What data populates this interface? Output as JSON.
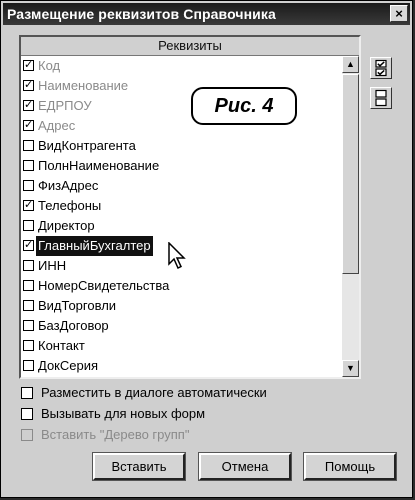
{
  "window": {
    "title": "Размещение реквизитов Справочника",
    "close_glyph": "×"
  },
  "list": {
    "header": "Реквизиты",
    "check_glyph": "✓",
    "items": [
      {
        "label": "Код",
        "checked": true,
        "disabled": true
      },
      {
        "label": "Наименование",
        "checked": true,
        "disabled": true
      },
      {
        "label": "ЕДРПОУ",
        "checked": true,
        "disabled": true
      },
      {
        "label": "Адрес",
        "checked": true,
        "disabled": true
      },
      {
        "label": "ВидКонтрагента",
        "checked": false,
        "disabled": false
      },
      {
        "label": "ПолнНаименование",
        "checked": false,
        "disabled": false
      },
      {
        "label": "ФизАдрес",
        "checked": false,
        "disabled": false
      },
      {
        "label": "Телефоны",
        "checked": true,
        "disabled": false
      },
      {
        "label": "Директор",
        "checked": false,
        "disabled": false
      },
      {
        "label": "ГлавныйБухгалтер",
        "checked": true,
        "disabled": false,
        "selected": true
      },
      {
        "label": "ИНН",
        "checked": false,
        "disabled": false
      },
      {
        "label": "НомерСвидетельства",
        "checked": false,
        "disabled": false
      },
      {
        "label": "ВидТорговли",
        "checked": false,
        "disabled": false
      },
      {
        "label": "БазДоговор",
        "checked": false,
        "disabled": false
      },
      {
        "label": "Контакт",
        "checked": false,
        "disabled": false
      },
      {
        "label": "ДокСерия",
        "checked": false,
        "disabled": false
      }
    ]
  },
  "scrollbar": {
    "up_glyph": "▲",
    "down_glyph": "▼"
  },
  "side_buttons": [
    {
      "icon": "check-all-icon"
    },
    {
      "icon": "uncheck-all-icon"
    }
  ],
  "figure_label": "Рис. 4",
  "options": [
    {
      "label": "Разместить в диалоге автоматически",
      "checked": false,
      "disabled": false
    },
    {
      "label": "Вызывать для новых форм",
      "checked": false,
      "disabled": false
    },
    {
      "label": "Вставить \"Дерево групп\"",
      "checked": false,
      "disabled": true
    }
  ],
  "buttons": {
    "insert": "Вставить",
    "cancel": "Отмена",
    "help": "Помощь"
  },
  "colors": {
    "dialog_bg": "#cfcfcf",
    "selection_bg": "#111111",
    "disabled_text": "#8a8a8a"
  }
}
